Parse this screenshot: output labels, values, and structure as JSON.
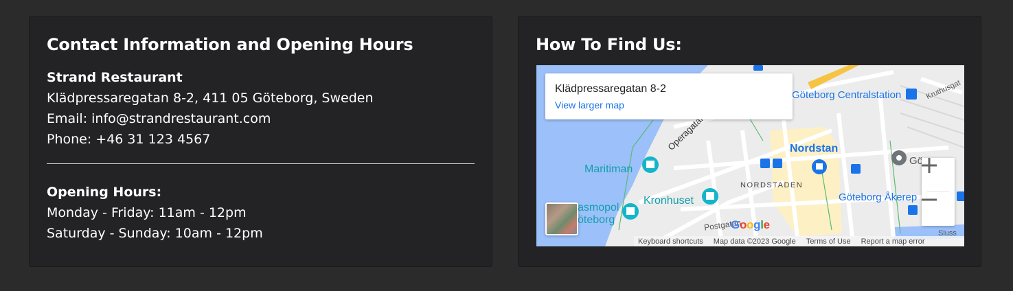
{
  "contact": {
    "title": "Contact Information and Opening Hours",
    "name": "Strand Restaurant",
    "address": "Klädpressaregatan 8-2, 411 05 Göteborg, Sweden",
    "email": "Email: info@strandrestaurant.com",
    "phone": "Phone: +46 31 123 4567",
    "hours_title": "Opening Hours:",
    "hours": [
      "Monday - Friday: 11am - 12pm",
      "Saturday - Sunday: 10am - 12pm"
    ]
  },
  "find": {
    "title": "How To Find Us:",
    "map": {
      "place_name": "Klädpressaregatan 8-2",
      "view_larger": "View larger map",
      "labels": {
        "centralstation": "Göteborg Centralstation",
        "kruthusg": "Kruthusgat",
        "operagatan": "Operagatan",
        "nordstan": "Nordstan",
        "maritiman": "Maritiman",
        "nordstaden": "NORDSTADEN",
        "kronhuset": "Kronhuset",
        "cosmopol": "asmopol",
        "goteborg": "öteborg",
        "akerep": "Göteborg Åkerep",
        "gote": "Gö",
        "postgatan": "Postgatan",
        "slussen": "Sluss",
        "google": "Google"
      },
      "zoom_in": "+",
      "zoom_out": "−",
      "attribution": {
        "shortcuts": "Keyboard shortcuts",
        "mapdata": "Map data ©2023 Google",
        "terms": "Terms of Use",
        "report": "Report a map error"
      },
      "colors": {
        "water": "#9cc0f9",
        "road": "#ffffff",
        "land": "#ececec",
        "highlight": "#fdf0c5",
        "accent": "#1a73e8"
      }
    }
  }
}
